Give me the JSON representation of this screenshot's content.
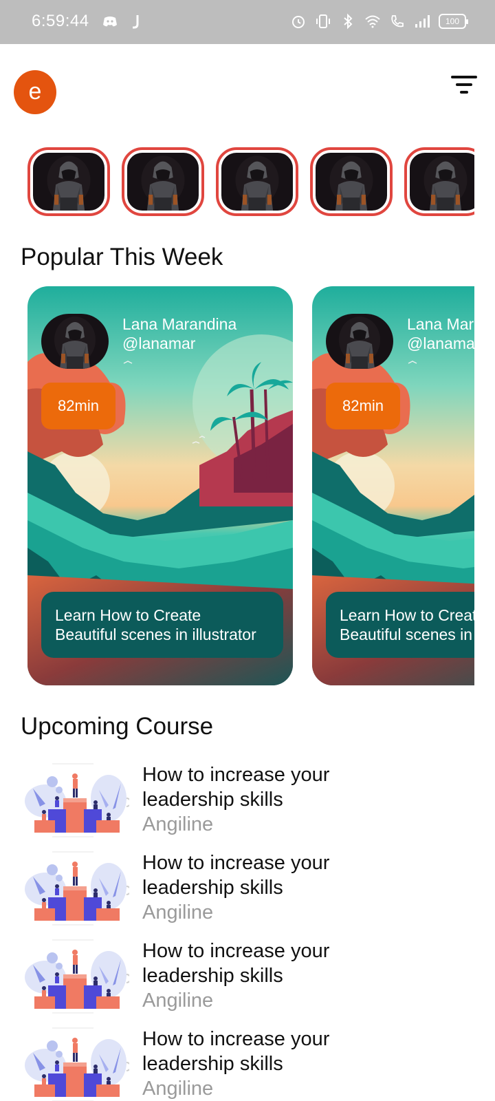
{
  "status_bar": {
    "time": "6:59:44",
    "left_icons": [
      "discord-icon",
      "j-notification-icon"
    ],
    "right_icons": [
      "alarm-icon",
      "vibrate-icon",
      "bluetooth-icon",
      "wifi-icon",
      "wifi-call-icon",
      "signal-icon",
      "battery-icon"
    ],
    "battery_level": "100"
  },
  "header": {
    "avatar_letter": "e",
    "avatar_color": "#e4540f",
    "filter_icon": "filter-icon"
  },
  "stories": {
    "count": 5,
    "ring_color": "#e0463f",
    "image": "hooded-person-photo"
  },
  "popular": {
    "title": "Popular This Week",
    "cards": [
      {
        "author_name": "Lana Marandina",
        "author_handle": "@lanamar",
        "duration": "82min",
        "caption": "Learn How to Create\nBeautiful scenes in illustrator"
      },
      {
        "author_name": "Lana Marandina",
        "author_handle": "@lanamar",
        "duration": "82min",
        "caption": "Learn How to Create\nBeautiful scenes in illustrator"
      }
    ],
    "duration_badge_color": "#ec6a0b",
    "caption_bg_color": "#0c5b5a"
  },
  "upcoming": {
    "title": "Upcoming Course",
    "courses": [
      {
        "title": "How to increase your\nleadership skills",
        "author": "Angiline"
      },
      {
        "title": "How to increase your\nleadership skills",
        "author": "Angiline"
      },
      {
        "title": "How to increase your\nleadership skills",
        "author": "Angiline"
      },
      {
        "title": "How to increase your\nleadership skills",
        "author": "Angiline"
      }
    ]
  }
}
